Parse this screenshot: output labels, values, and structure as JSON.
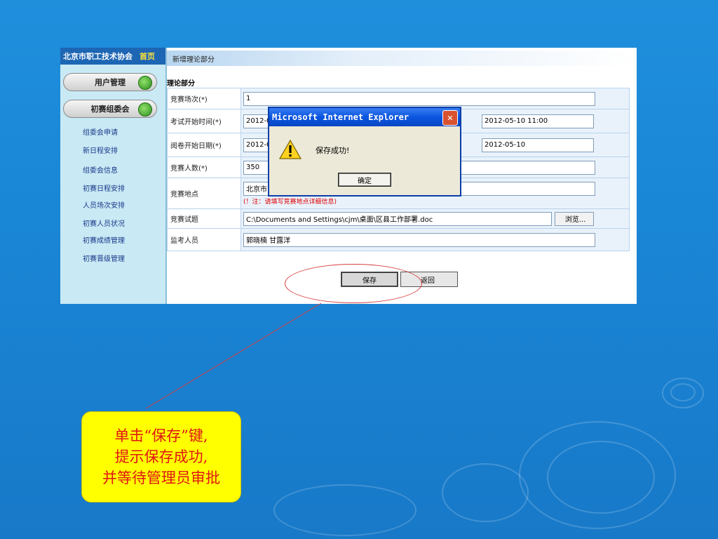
{
  "sidebar": {
    "org_name": "北京市职工技术协会",
    "home_link": "首页",
    "menu_user": "用户管理",
    "menu_committee": "初赛组委会",
    "links": [
      "组委会申请",
      "新日程安排",
      "组委会信息",
      "初赛日程安排",
      "人员场次安排",
      "初赛人员状况",
      "初赛成绩管理",
      "初赛晋级管理"
    ]
  },
  "tab": {
    "label": "新增理论部分"
  },
  "section": {
    "title": "理论部分"
  },
  "form": {
    "session_label": "竞赛场次(*)",
    "session_value": "1",
    "exam_start_label": "考试开始时间(*)",
    "exam_start_value": "2012-05",
    "exam_end_value": "2012-05-10 11:00",
    "review_start_label": "阅卷开始日期(*)",
    "review_start_value": "2012-05",
    "review_end_value": "2012-05-10",
    "count_label": "竞赛人数(*)",
    "count_value": "350",
    "location_label": "竞赛地点",
    "location_value": "北京市东",
    "location_note": "(！注：请填写竞赛地点详细信息)",
    "paper_label": "竞赛试题",
    "paper_value": "C:\\Documents and Settings\\cjm\\桌面\\区县工作部署.doc",
    "browse_label": "浏览...",
    "proctor_label": "监考人员",
    "proctor_value": "郭晓楠 甘露洋"
  },
  "actions": {
    "save": "保存",
    "back": "返回"
  },
  "dialog": {
    "title": "Microsoft Internet Explorer",
    "message": "保存成功!",
    "ok": "确定",
    "close_glyph": "✕"
  },
  "callout": {
    "lines": [
      "单击“保存”键,",
      "提示保存成功,",
      "并等待管理员审批"
    ]
  },
  "colors": {
    "slide_bg": "#1a86d6",
    "callout_bg": "#ffff00",
    "callout_text": "#e01515",
    "dialog_title": "#0a55e0"
  }
}
